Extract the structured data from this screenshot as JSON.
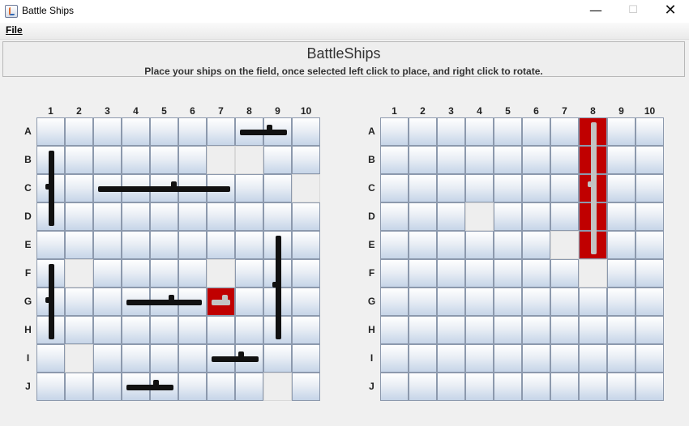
{
  "window": {
    "title": "Battle Ships",
    "minimize_glyph": "—",
    "maximize_glyph": "☐",
    "close_glyph": "✕",
    "icon": "java-cup-icon"
  },
  "menu": {
    "file_label": "File"
  },
  "header": {
    "title": "BattleShips",
    "subtitle": "Place your ships on the field, once selected left click to place, and right click to rotate."
  },
  "columns": [
    "1",
    "2",
    "3",
    "4",
    "5",
    "6",
    "7",
    "8",
    "9",
    "10"
  ],
  "rows": [
    "A",
    "B",
    "C",
    "D",
    "E",
    "F",
    "G",
    "H",
    "I",
    "J"
  ],
  "colors": {
    "hit": "#c00000",
    "cell_top": "#ffffff",
    "cell_bottom": "#c6d5e8",
    "ship": "#111111"
  },
  "player_board": {
    "blank_cells": [
      "B7",
      "B8",
      "C10",
      "F2",
      "F7",
      "I2",
      "J9"
    ],
    "hit_cells": [
      "G7"
    ],
    "ships": [
      {
        "name": "destroyer",
        "cells": [
          "A8",
          "A9"
        ],
        "orientation": "horizontal",
        "color": "black"
      },
      {
        "name": "battleship",
        "cells": [
          "B1",
          "C1",
          "D1"
        ],
        "orientation": "vertical",
        "color": "black"
      },
      {
        "name": "carrier",
        "cells": [
          "C3",
          "C4",
          "C5",
          "C6",
          "C7"
        ],
        "orientation": "horizontal",
        "color": "black"
      },
      {
        "name": "cruiser",
        "cells": [
          "E9",
          "F9",
          "G9",
          "H9"
        ],
        "orientation": "vertical",
        "color": "black"
      },
      {
        "name": "submarine",
        "cells": [
          "F1",
          "G1",
          "H1"
        ],
        "orientation": "vertical",
        "color": "black"
      },
      {
        "name": "cruiser-2",
        "cells": [
          "G4",
          "G5",
          "G6"
        ],
        "orientation": "horizontal",
        "color": "black"
      },
      {
        "name": "cruiser-2-hit-part",
        "cells": [
          "G7"
        ],
        "orientation": "horizontal",
        "color": "grey"
      },
      {
        "name": "patrol-boat",
        "cells": [
          "I7",
          "I8"
        ],
        "orientation": "horizontal",
        "color": "black"
      },
      {
        "name": "patrol-boat-2",
        "cells": [
          "J4",
          "J5"
        ],
        "orientation": "horizontal",
        "color": "black"
      }
    ]
  },
  "enemy_board": {
    "blank_cells": [
      "D4",
      "E7",
      "F8"
    ],
    "hit_cells": [
      "A8",
      "B8",
      "C8",
      "D8",
      "E8"
    ],
    "ships": [
      {
        "name": "sunk-carrier",
        "cells": [
          "A8",
          "B8",
          "C8",
          "D8",
          "E8"
        ],
        "orientation": "vertical",
        "color": "grey"
      }
    ]
  }
}
